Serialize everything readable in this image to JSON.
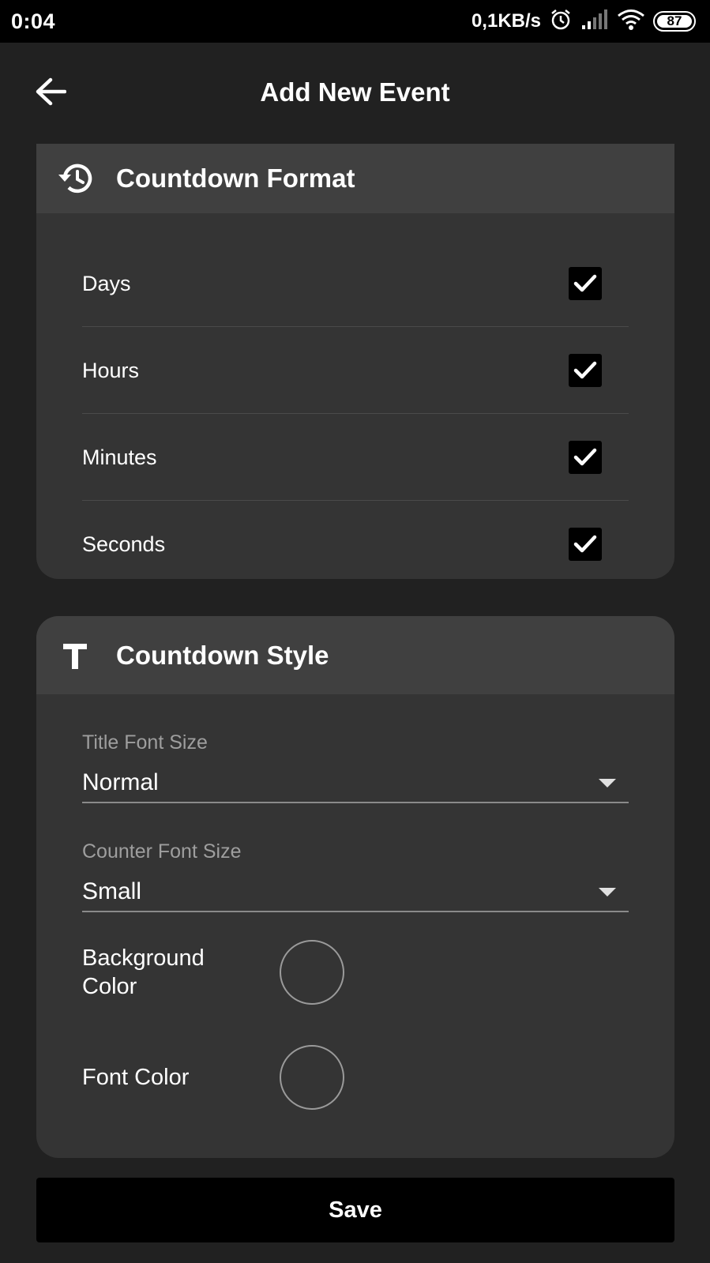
{
  "status_bar": {
    "time": "0:04",
    "speed": "0,1KB/s",
    "battery": "87"
  },
  "app_bar": {
    "title": "Add New Event",
    "back_icon": "arrow-left-icon"
  },
  "countdown_format": {
    "title": "Countdown Format",
    "icon": "history-icon",
    "options": [
      {
        "label": "Days",
        "checked": true
      },
      {
        "label": "Hours",
        "checked": true
      },
      {
        "label": "Minutes",
        "checked": true
      },
      {
        "label": "Seconds",
        "checked": true
      }
    ]
  },
  "countdown_style": {
    "title": "Countdown Style",
    "icon": "text-format-icon",
    "title_font_size": {
      "label": "Title Font Size",
      "value": "Normal"
    },
    "counter_font_size": {
      "label": "Counter Font Size",
      "value": "Small"
    },
    "background_color_label": "Background\nColor",
    "font_color_label": "Font Color"
  },
  "save_label": "Save",
  "colors": {
    "background": "#212121",
    "card": "#343434",
    "card_header": "#404040",
    "button": "#000000"
  }
}
